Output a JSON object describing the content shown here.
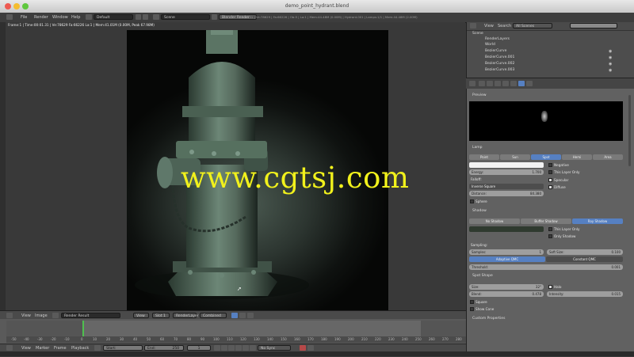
{
  "window": {
    "title": "demo_point_hydrant.blend"
  },
  "menubar": {
    "items": [
      "File",
      "Render",
      "Window",
      "Help"
    ],
    "layout_value": "Default",
    "scene_value": "Scene",
    "engine_value": "Blender Render",
    "stats": "Fra:131 | Ve:78629 | Fa:66226 | Ob:5 | La:1 | Mem:44.48M (0.00M) | Hydrant.001 | Lamps:1/1 | Mem:44.48M (2.00M)"
  },
  "viewport": {
    "info": "Frame:1 | Time:00:01.31 | Ve:78629 Fa:66226 La:1 | Mem:41.01M (0.00M, Peak 67.98M)"
  },
  "watermark": "www.cgtsj.com",
  "image_header": {
    "items": [
      "View",
      "Image"
    ],
    "image_name": "Render Result",
    "view_label": "View",
    "slot": "Slot 1",
    "layer": "RenderLayer",
    "pass": "Combined"
  },
  "timeline": {
    "ticks": [
      "-50",
      "-40",
      "-30",
      "-20",
      "-10",
      "0",
      "10",
      "20",
      "30",
      "40",
      "50",
      "60",
      "70",
      "80",
      "90",
      "100",
      "110",
      "120",
      "130",
      "140",
      "150",
      "160",
      "170",
      "180",
      "190",
      "200",
      "210",
      "220",
      "230",
      "240",
      "250",
      "260",
      "270",
      "280"
    ],
    "menu": [
      "View",
      "Marker",
      "Frame",
      "Playback"
    ],
    "start_label": "Start:",
    "start_value": "1",
    "end_label": "End:",
    "end_value": "250",
    "current": "1",
    "sync": "No Sync"
  },
  "outliner": {
    "header_items": [
      "View",
      "Search"
    ],
    "filter": "All Scenes",
    "rows": [
      "Scene",
      "RenderLayers",
      "World",
      "BezierCurve",
      "BezierCurve.001",
      "BezierCurve.002",
      "BezierCurve.003"
    ]
  },
  "properties": {
    "preview_label": "Preview",
    "lamp_label": "Lamp",
    "lamp_types": [
      "Point",
      "Sun",
      "Spot",
      "Hemi",
      "Area"
    ],
    "energy_label": "Energy:",
    "energy_value": "1.700",
    "falloff_label": "Falloff:",
    "falloff_value": "Inverse Square",
    "distance_label": "Distance:",
    "distance_value": "84.380",
    "sphere_label": "Sphere",
    "negative_label": "Negative",
    "this_layer_label": "This Layer Only",
    "specular_label": "Specular",
    "diffuse_label": "Diffuse",
    "shadow_label": "Shadow",
    "shadow_types": [
      "No Shadow",
      "Buffer Shadow",
      "Ray Shadow"
    ],
    "shadow_this_layer": "This Layer Only",
    "only_shadow": "Only Shadow",
    "sampling_label": "Sampling:",
    "samples_label": "Samples:",
    "samples_value": "1",
    "soft_size_label": "Soft Size:",
    "soft_size_value": "0.100",
    "qmc_types": [
      "Adaptive QMC",
      "Constant QMC"
    ],
    "threshold_label": "Threshold:",
    "threshold_value": "0.001",
    "spot_shape_label": "Spot Shape",
    "size_label": "Size:",
    "size_value": "32°",
    "blend_label": "Blend:",
    "blend_value": "0.478",
    "halo_label": "Halo",
    "intensity_label": "Intensity:",
    "intensity_value": "0.015",
    "square_label": "Square",
    "show_cone_label": "Show Cone",
    "custom_props_label": "Custom Properties"
  },
  "colors": {
    "accent_blue": "#5680c2",
    "watermark": "#f1f11c",
    "timeline_cursor": "#4fc04f"
  }
}
